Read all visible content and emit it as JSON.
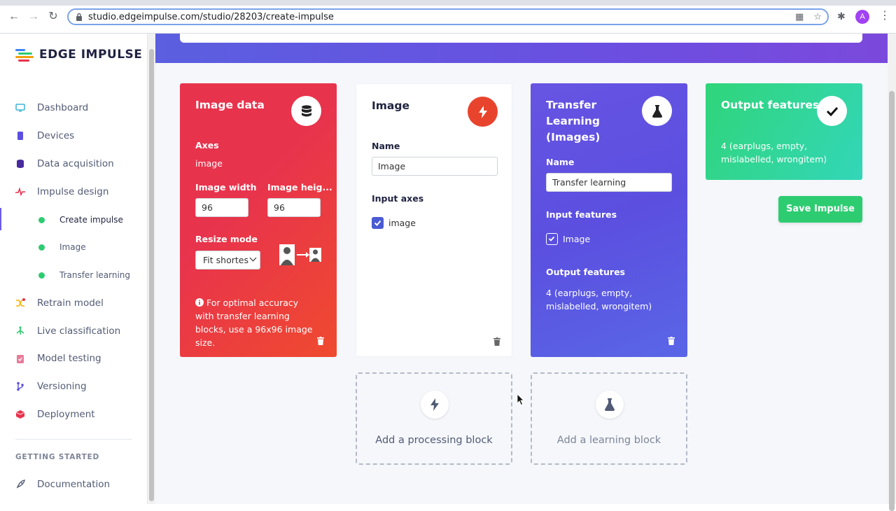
{
  "browser": {
    "url": "studio.edgeimpulse.com/studio/28203/create-impulse",
    "avatar_letter": "A"
  },
  "sidebar": {
    "logo_text": "EDGE IMPULSE",
    "items": [
      {
        "label": "Dashboard",
        "icon": "monitor-icon"
      },
      {
        "label": "Devices",
        "icon": "chip-icon"
      },
      {
        "label": "Data acquisition",
        "icon": "database-icon"
      },
      {
        "label": "Impulse design",
        "icon": "pulse-icon"
      },
      {
        "label": "Retrain model",
        "icon": "shuffle-icon"
      },
      {
        "label": "Live classification",
        "icon": "tree-icon"
      },
      {
        "label": "Model testing",
        "icon": "clipboard-check-icon"
      },
      {
        "label": "Versioning",
        "icon": "branch-icon"
      },
      {
        "label": "Deployment",
        "icon": "cube-icon"
      },
      {
        "label": "Documentation",
        "icon": "rocket-icon"
      }
    ],
    "sub_items": [
      {
        "label": "Create impulse",
        "active": true
      },
      {
        "label": "Image",
        "active": false
      },
      {
        "label": "Transfer learning",
        "active": false
      }
    ],
    "section_title": "GETTING STARTED"
  },
  "blocks": {
    "input": {
      "title": "Image data",
      "axes_label": "Axes",
      "axes_value": "image",
      "width_label": "Image width",
      "width_value": "96",
      "height_label": "Image heig...",
      "height_value": "96",
      "resize_label": "Resize mode",
      "resize_value": "Fit shortes",
      "info_text": "For optimal accuracy with transfer learning blocks, use a 96x96 image size."
    },
    "processing": {
      "title": "Image",
      "name_label": "Name",
      "name_value": "Image",
      "axes_label": "Input axes",
      "axes_option": "image"
    },
    "learning": {
      "title": "Transfer Learning (Images)",
      "name_label": "Name",
      "name_value": "Transfer learning",
      "features_label": "Input features",
      "features_option": "Image",
      "output_label": "Output features",
      "output_value": "4 (earplugs, empty, mislabelled, wrongitem)"
    },
    "output": {
      "title": "Output features",
      "value": "4 (earplugs, empty, mislabelled, wrongitem)"
    }
  },
  "actions": {
    "save": "Save Impulse",
    "add_processing": "Add a processing block",
    "add_learning": "Add a learning block"
  },
  "colors": {
    "input_block": "#e8334d",
    "learning_block": "#6754e2",
    "output_block": "#30d57a",
    "accent_green": "#2ecc71"
  }
}
